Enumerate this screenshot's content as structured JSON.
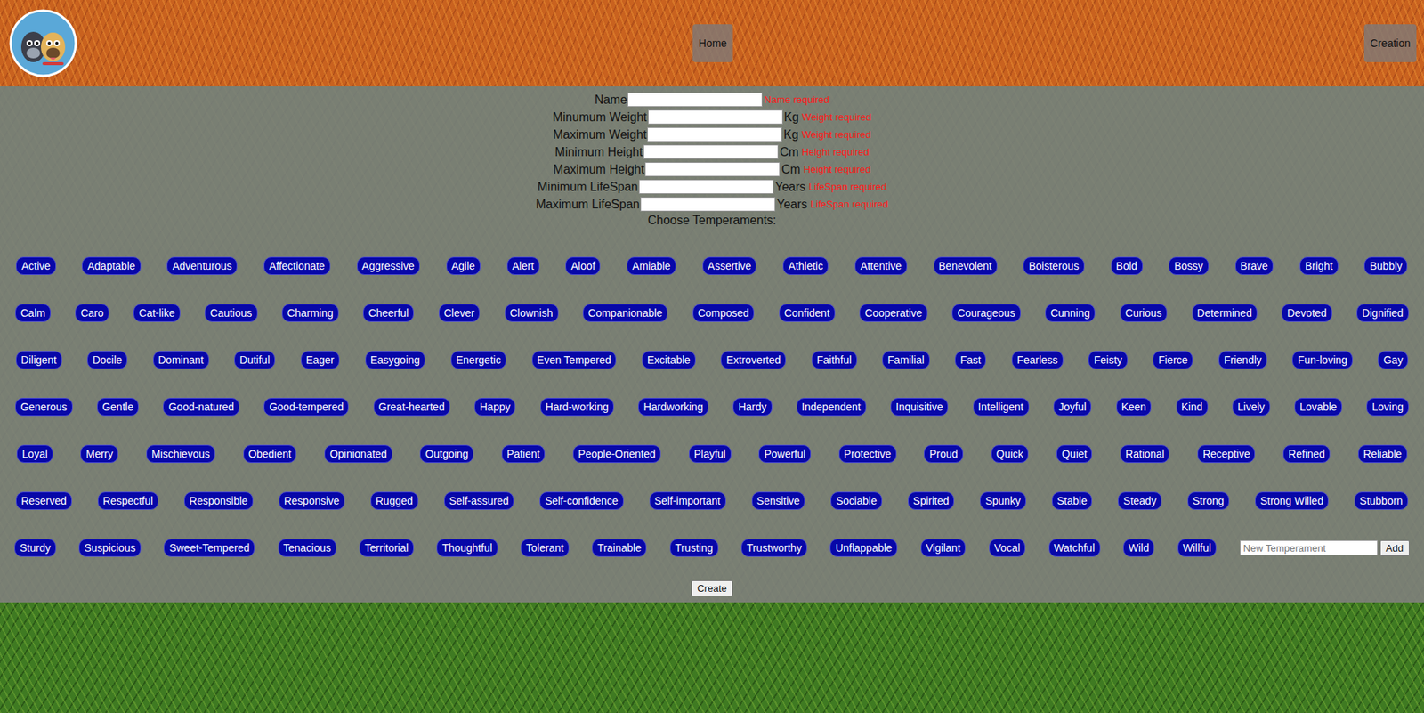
{
  "header": {
    "nav": [
      {
        "label": "Home"
      },
      {
        "label": "Creation"
      }
    ]
  },
  "form": {
    "fields": [
      {
        "label": "Name",
        "unit": "",
        "error": "Name required"
      },
      {
        "label": "Minumum Weight",
        "unit": "Kg",
        "error": "Weight required"
      },
      {
        "label": "Maximum Weight",
        "unit": "Kg",
        "error": "Weight required"
      },
      {
        "label": "Minimum Height",
        "unit": "Cm",
        "error": "Height required"
      },
      {
        "label": "Maximum Height",
        "unit": "Cm",
        "error": "Height required"
      },
      {
        "label": "Minimum LifeSpan",
        "unit": "Years",
        "error": "LifeSpan required"
      },
      {
        "label": "Maximum LifeSpan",
        "unit": "Years",
        "error": "LifeSpan required"
      }
    ],
    "temperaments_label": "Choose Temperaments:",
    "temperament_rows": [
      [
        "Active",
        "Adaptable",
        "Adventurous",
        "Affectionate",
        "Aggressive",
        "Agile",
        "Alert",
        "Aloof",
        "Amiable",
        "Assertive",
        "Athletic",
        "Attentive",
        "Benevolent",
        "Boisterous",
        "Bold",
        "Bossy",
        "Brave",
        "Bright",
        "Bubbly"
      ],
      [
        "Calm",
        "Caro",
        "Cat-like",
        "Cautious",
        "Charming",
        "Cheerful",
        "Clever",
        "Clownish",
        "Companionable",
        "Composed",
        "Confident",
        "Cooperative",
        "Courageous",
        "Cunning",
        "Curious",
        "Determined",
        "Devoted",
        "Dignified"
      ],
      [
        "Diligent",
        "Docile",
        "Dominant",
        "Dutiful",
        "Eager",
        "Easygoing",
        "Energetic",
        "Even Tempered",
        "Excitable",
        "Extroverted",
        "Faithful",
        "Familial",
        "Fast",
        "Fearless",
        "Feisty",
        "Fierce",
        "Friendly",
        "Fun-loving",
        "Gay"
      ],
      [
        "Generous",
        "Gentle",
        "Good-natured",
        "Good-tempered",
        "Great-hearted",
        "Happy",
        "Hard-working",
        "Hardworking",
        "Hardy",
        "Independent",
        "Inquisitive",
        "Intelligent",
        "Joyful",
        "Keen",
        "Kind",
        "Lively",
        "Lovable",
        "Loving"
      ],
      [
        "Loyal",
        "Merry",
        "Mischievous",
        "Obedient",
        "Opinionated",
        "Outgoing",
        "Patient",
        "People-Oriented",
        "Playful",
        "Powerful",
        "Protective",
        "Proud",
        "Quick",
        "Quiet",
        "Rational",
        "Receptive",
        "Refined",
        "Reliable"
      ],
      [
        "Reserved",
        "Respectful",
        "Responsible",
        "Responsive",
        "Rugged",
        "Self-assured",
        "Self-confidence",
        "Self-important",
        "Sensitive",
        "Sociable",
        "Spirited",
        "Spunky",
        "Stable",
        "Steady",
        "Strong",
        "Strong Willed",
        "Stubborn"
      ],
      [
        "Sturdy",
        "Suspicious",
        "Sweet-Tempered",
        "Tenacious",
        "Territorial",
        "Thoughtful",
        "Tolerant",
        "Trainable",
        "Trusting",
        "Trustworthy",
        "Unflappable",
        "Vigilant",
        "Vocal",
        "Watchful",
        "Wild",
        "Willful"
      ]
    ],
    "new_temperament": {
      "placeholder": "New Temperament",
      "button": "Add"
    },
    "submit": "Create"
  }
}
